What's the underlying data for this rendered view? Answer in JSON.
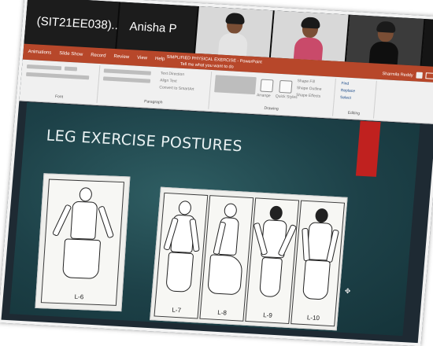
{
  "participants": {
    "tile1_name": "(SIT21EE038)...",
    "tile2_name": "Anisha P"
  },
  "titlebar": {
    "menu": [
      "Animations",
      "Slide Show",
      "Record",
      "Review",
      "View",
      "Help"
    ],
    "document_title": "SIMPLIFIED   PHYSICAL  EXERCISE  -  PowerPoint",
    "tell_me": "Tell me what you want to do",
    "user_name": "Sharmila Reddy"
  },
  "ribbon": {
    "groups": [
      "Font",
      "Paragraph",
      "Drawing",
      "Editing"
    ],
    "paragraph_items": [
      "Text Direction",
      "Align Text",
      "Convert to SmartArt"
    ],
    "drawing_items": [
      "Arrange",
      "Quick Styles",
      "Shape Fill",
      "Shape Outline",
      "Shape Effects"
    ],
    "editing_items": [
      "Find",
      "Replace",
      "Select"
    ]
  },
  "slide": {
    "title": "LEG EXERCISE POSTURES",
    "figure_labels": [
      "L-6",
      "L-7",
      "L-8",
      "L-9",
      "L-10"
    ],
    "accent_color": "#c0211f",
    "background_color": "#1d4148"
  }
}
